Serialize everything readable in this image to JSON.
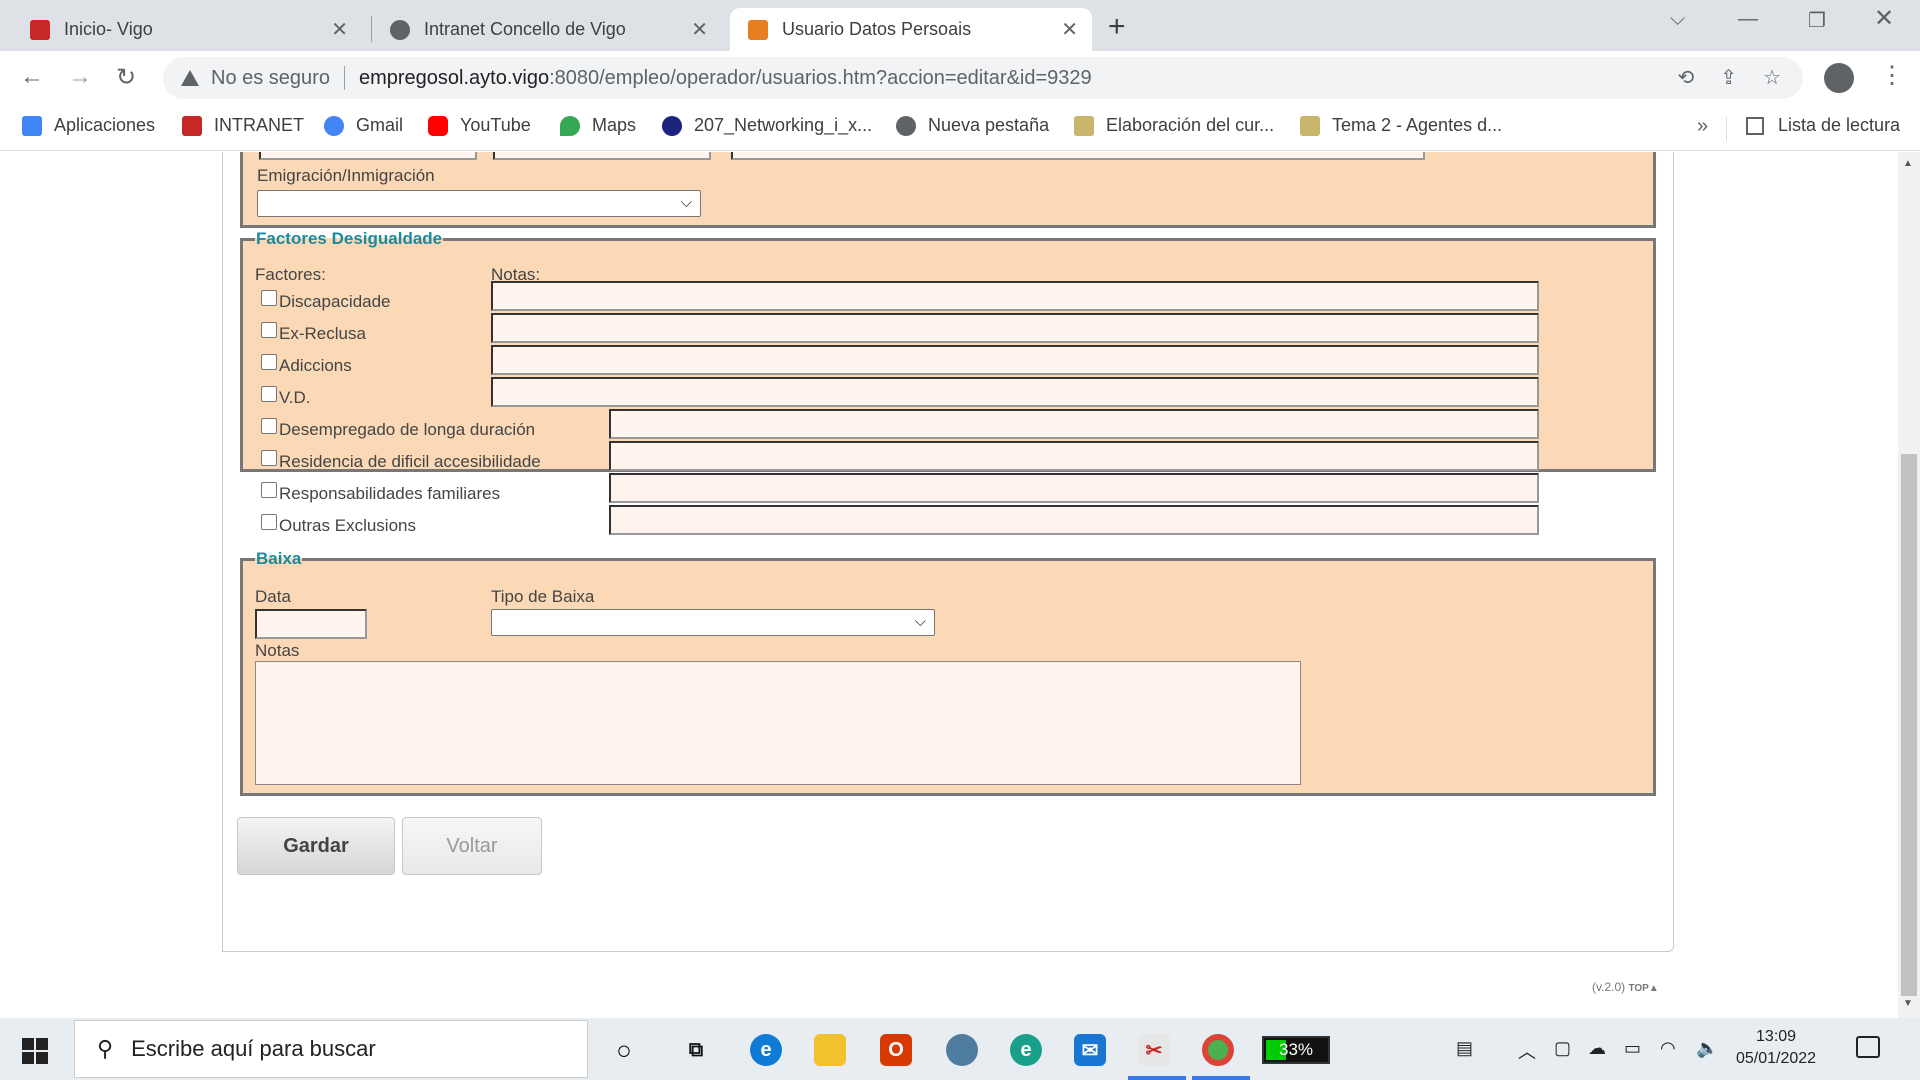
{
  "browser": {
    "tabs": [
      {
        "title": "Inicio- Vigo",
        "favicon_color": "#c62828"
      },
      {
        "title": "Intranet Concello de Vigo",
        "favicon_color": "#5f6368"
      },
      {
        "title": "Usuario Datos Persoais",
        "favicon_color": "#e67e22"
      }
    ],
    "address": {
      "security_label": "No es seguro",
      "host": "empregosol.ayto.vigo",
      "path": ":8080/empleo/operador/usuarios.htm?accion=editar&id=9329"
    },
    "bookmarks": [
      {
        "label": "Aplicaciones",
        "icon": "apps-grid-icon",
        "color": "#4285f4"
      },
      {
        "label": "INTRANET",
        "icon": "vigo-crest-icon",
        "color": "#c62828"
      },
      {
        "label": "Gmail",
        "icon": "google-icon",
        "color": "#4285f4"
      },
      {
        "label": "YouTube",
        "icon": "youtube-icon",
        "color": "#ff0000"
      },
      {
        "label": "Maps",
        "icon": "maps-pin-icon",
        "color": "#34a853"
      },
      {
        "label": "207_Networking_i_x...",
        "icon": "networking-icon",
        "color": "#1a237e"
      },
      {
        "label": "Nueva pestaña",
        "icon": "globe-icon",
        "color": "#5f6368"
      },
      {
        "label": "Elaboración del cur...",
        "icon": "document-icon",
        "color": "#c8b46a"
      },
      {
        "label": "Tema 2 - Agentes d...",
        "icon": "document-icon",
        "color": "#c8b46a"
      }
    ],
    "bookmarks_more": "»",
    "reading_list": "Lista de lectura"
  },
  "form": {
    "emigration": {
      "label": "Emigración/Inmigración",
      "value": ""
    },
    "factores": {
      "legend": "Factores Desigualdade",
      "factors_label": "Factores:",
      "notes_label": "Notas:",
      "items": [
        {
          "label": "Discapacidade",
          "checked": false,
          "note": ""
        },
        {
          "label": "Ex-Reclusa",
          "checked": false,
          "note": ""
        },
        {
          "label": "Adiccions",
          "checked": false,
          "note": ""
        },
        {
          "label": "V.D.",
          "checked": false,
          "note": ""
        },
        {
          "label": "Desempregado de longa duración",
          "checked": false,
          "note": ""
        },
        {
          "label": "Residencia de dificil accesibilidade",
          "checked": false,
          "note": ""
        },
        {
          "label": "Responsabilidades familiares",
          "checked": false,
          "note": ""
        },
        {
          "label": "Outras Exclusions",
          "checked": false,
          "note": ""
        }
      ]
    },
    "baixa": {
      "legend": "Baixa",
      "date_label": "Data",
      "date_value": "",
      "type_label": "Tipo de Baixa",
      "type_value": "",
      "notes_label": "Notas",
      "notes_value": ""
    },
    "buttons": {
      "save": "Gardar",
      "back": "Voltar"
    },
    "version": "(v.2.0)",
    "top_link": "TOP"
  },
  "taskbar": {
    "search_placeholder": "Escribe aquí para buscar",
    "battery_app_label": "33%",
    "time": "13:09",
    "date": "05/01/2022"
  },
  "colors": {
    "panel_bg": "#fcd9b6",
    "legend": "#1a8aa0",
    "input_bg": "#fff5ee"
  }
}
